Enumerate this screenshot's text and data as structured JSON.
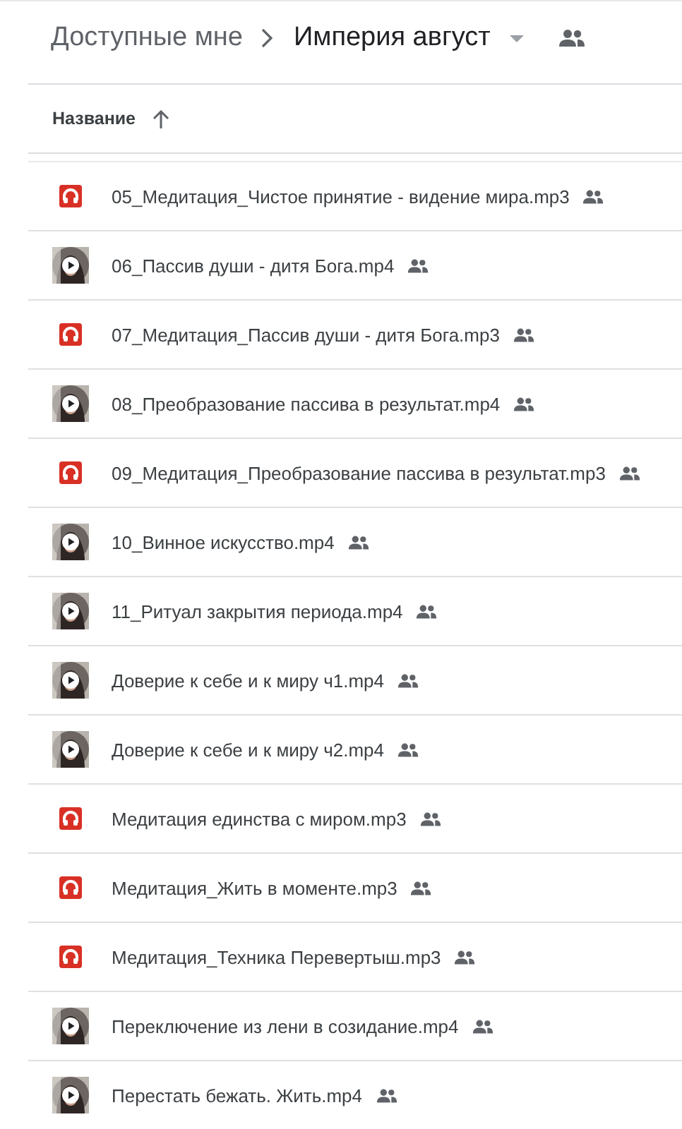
{
  "breadcrumb": {
    "parent": "Доступные мне",
    "current": "Империя август",
    "shared": true
  },
  "list_header": {
    "column": "Название",
    "sort_ascending": true
  },
  "files": [
    {
      "kind": "audio",
      "name": "05_Медитация_Чистое принятие - видение мира.mp3",
      "shared": true
    },
    {
      "kind": "video",
      "name": "06_Пассив души - дитя Бога.mp4",
      "shared": true
    },
    {
      "kind": "audio",
      "name": "07_Медитация_Пассив души - дитя Бога.mp3",
      "shared": true
    },
    {
      "kind": "video",
      "name": "08_Преобразование пассива в результат.mp4",
      "shared": true
    },
    {
      "kind": "audio",
      "name": "09_Медитация_Преобразование пассива в результат.mp3",
      "shared": true
    },
    {
      "kind": "video",
      "name": "10_Винное искусство.mp4",
      "shared": true
    },
    {
      "kind": "video",
      "name": "11_Ритуал закрытия периода.mp4",
      "shared": true
    },
    {
      "kind": "video",
      "name": "Доверие к себе и к миру ч1.mp4",
      "shared": true
    },
    {
      "kind": "video",
      "name": "Доверие к себе и к миру ч2.mp4",
      "shared": true
    },
    {
      "kind": "audio",
      "name": "Медитация единства с миром.mp3",
      "shared": true
    },
    {
      "kind": "audio",
      "name": "Медитация_Жить в моменте.mp3",
      "shared": true
    },
    {
      "kind": "audio",
      "name": "Медитация_Техника Перевертыш.mp3",
      "shared": true
    },
    {
      "kind": "video",
      "name": "Переключение из лени в созидание.mp4",
      "shared": true
    },
    {
      "kind": "video",
      "name": "Перестать бежать. Жить.mp4",
      "shared": true
    }
  ]
}
